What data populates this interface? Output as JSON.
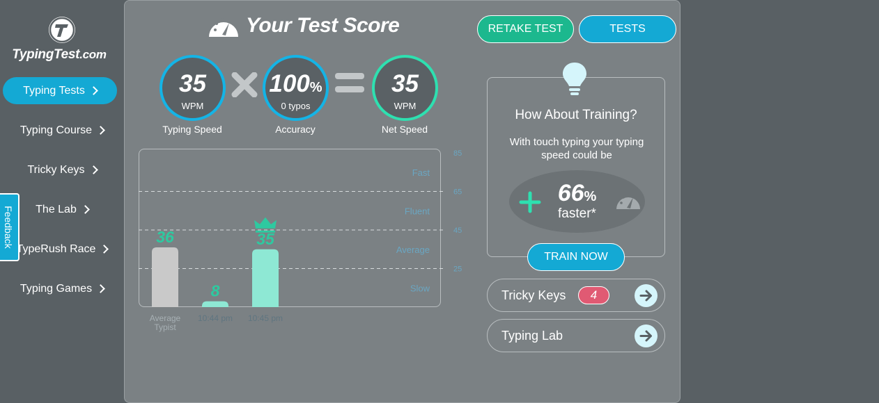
{
  "logo": {
    "text": "TypingTest",
    "suffix": ".com"
  },
  "sidebar": {
    "items": [
      {
        "label": "Typing Tests"
      },
      {
        "label": "Typing Course"
      },
      {
        "label": "Tricky Keys"
      },
      {
        "label": "The Lab"
      },
      {
        "label": "TypeRush Race"
      },
      {
        "label": "Typing Games"
      }
    ],
    "feedback_label": "Feedback"
  },
  "header": {
    "title": "Your Test Score",
    "retake_label": "RETAKE TEST",
    "tests_label": "TESTS"
  },
  "stats": {
    "speed": {
      "value": "35",
      "unit": "WPM",
      "caption": "Typing Speed",
      "color": "#14b4e6"
    },
    "accuracy": {
      "value": "100",
      "unit_symbol": "%",
      "sub": "0  typos",
      "caption": "Accuracy",
      "color": "#14b4e6"
    },
    "net": {
      "value": "35",
      "unit": "WPM",
      "caption": "Net Speed",
      "color": "#2ee0b0"
    }
  },
  "chart_data": {
    "type": "bar",
    "categories": [
      "Average Typist",
      "10:44 pm",
      "10:45 pm"
    ],
    "values": [
      36,
      8,
      35
    ],
    "ylim": [
      5,
      85
    ],
    "y_ticks": [
      25,
      45,
      65,
      85
    ],
    "bands": [
      "Slow",
      "Average",
      "Fluent",
      "Fast"
    ],
    "best_index": 2,
    "colors": {
      "average": "#c9c9c9",
      "result": "#8ee8d4",
      "label": "#2ec9a0",
      "axis": "#6aa6c2"
    }
  },
  "training": {
    "title": "How About Training?",
    "text": "With touch typing your typing speed could be",
    "percent": "66",
    "percent_symbol": "%",
    "faster_label": "faster*",
    "button_label": "TRAIN NOW"
  },
  "links": {
    "tricky_keys": {
      "label": "Tricky Keys",
      "badge": "4"
    },
    "typing_lab": {
      "label": "Typing Lab"
    }
  }
}
